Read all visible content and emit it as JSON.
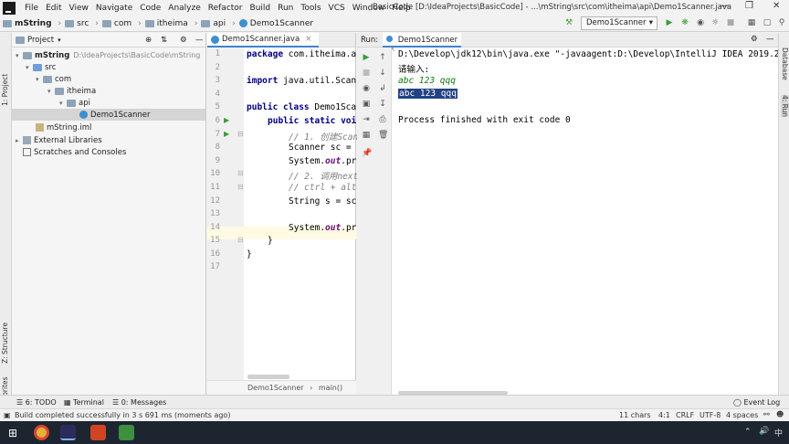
{
  "menubar": {
    "items": [
      "File",
      "Edit",
      "View",
      "Navigate",
      "Code",
      "Analyze",
      "Refactor",
      "Build",
      "Run",
      "Tools",
      "VCS",
      "Window",
      "Help"
    ],
    "title": "BasicCode [D:\\IdeaProjects\\BasicCode] - ...\\mString\\src\\com\\itheima\\api\\Demo1Scanner.java"
  },
  "navbar": {
    "crumbs": [
      "mString",
      "src",
      "com",
      "itheima",
      "api",
      "Demo1Scanner"
    ],
    "run_config": "Demo1Scanner"
  },
  "project": {
    "header": "Project",
    "tree": [
      {
        "label": "mString",
        "extra": "D:\\IdeaProjects\\BasicCode\\mString"
      },
      {
        "label": "src"
      },
      {
        "label": "com"
      },
      {
        "label": "itheima"
      },
      {
        "label": "api"
      },
      {
        "label": "Demo1Scanner"
      },
      {
        "label": "mString.iml"
      },
      {
        "label": "External Libraries"
      },
      {
        "label": "Scratches and Consoles"
      }
    ]
  },
  "side_labels": {
    "project": "1: Project",
    "structure": "Z: Structure",
    "favorites": "2: Favorites",
    "database": "Database",
    "run": "4: Run"
  },
  "editor": {
    "tab": "Demo1Scanner.java",
    "line_numbers": [
      "1",
      "2",
      "3",
      "4",
      "5",
      "6",
      "7",
      "8",
      "9",
      "10",
      "11",
      "12",
      "13",
      "14",
      "15",
      "16",
      "17"
    ],
    "lines": {
      "l1a": "package",
      "l1b": " com.itheima.a",
      "l3a": "import",
      "l3b": " java.util.Scann",
      "l5a": "public class",
      "l5b": " Demo1Scan",
      "l6a": "public static",
      "l6b": " voi",
      "l7": "// 1. 创建Scan",
      "l8": "Scanner sc = n",
      "l9a": "System.",
      "l9b": "out",
      "l9c": ".pr",
      "l10": "// 2. 调用next",
      "l11": "// ctrl + alt",
      "l12": "String s = sc",
      "l14a": "System.",
      "l14b": "out",
      "l14c": ".pr",
      "l15": "}",
      "l16": "}"
    },
    "breadcrumb": [
      "Demo1Scanner",
      "main()"
    ]
  },
  "run": {
    "label": "Run:",
    "tab": "Demo1Scanner",
    "output": {
      "cmd": "D:\\Develop\\jdk12\\bin\\java.exe \"-javaagent:D:\\Develop\\IntelliJ IDEA 2019.2",
      "prompt": "请输入:",
      "input": "abc 123 qqq",
      "echo": "abc 123 qqq",
      "finished": "Process finished with exit code 0"
    }
  },
  "bottom_tabs": {
    "todo": "6: TODO",
    "terminal": "Terminal",
    "messages": "0: Messages",
    "event_log": "Event Log"
  },
  "status": {
    "message": "Build completed successfully in 3 s 691 ms (moments ago)",
    "chars": "11 chars",
    "position": "4:1",
    "line_sep": "CRLF",
    "encoding": "UTF-8",
    "indent": "4 spaces"
  },
  "colors": {
    "accent": "#4083c9",
    "selection": "#214283",
    "output_input": "#0c7a0c"
  }
}
